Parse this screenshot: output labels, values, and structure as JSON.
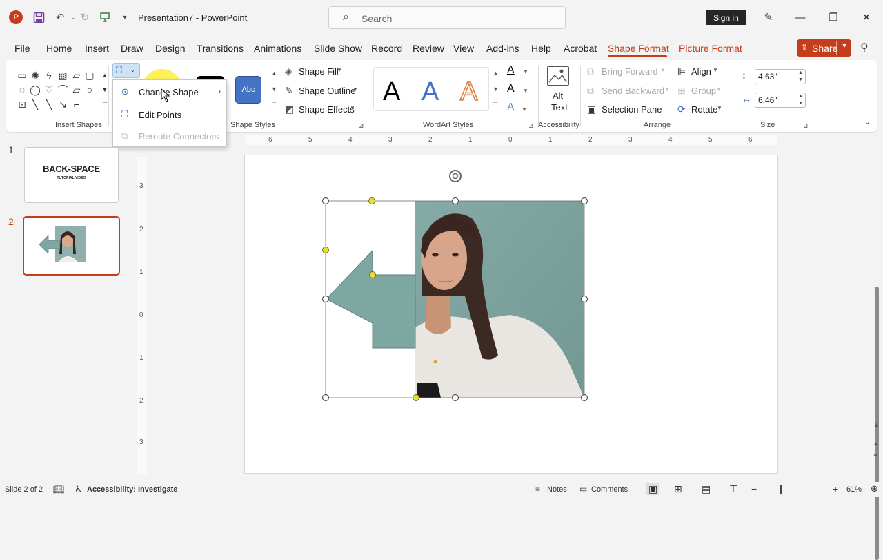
{
  "titlebar": {
    "doc_title": "Presentation7  -  PowerPoint",
    "search_placeholder": "Search",
    "signin_label": "Sign in"
  },
  "tabs": [
    "File",
    "Home",
    "Insert",
    "Draw",
    "Design",
    "Transitions",
    "Animations",
    "Slide Show",
    "Record",
    "Review",
    "View",
    "Add-ins",
    "Help",
    "Acrobat",
    "Shape Format",
    "Picture Format"
  ],
  "active_tab": "Shape Format",
  "share_label": "Share",
  "ribbon": {
    "groups": {
      "insert_shapes": "Insert Shapes",
      "shape_styles": "Shape Styles",
      "wordart_styles": "WordArt Styles",
      "accessibility": "Accessibility",
      "arrange": "Arrange",
      "size": "Size"
    },
    "style_sample_text": "Abc",
    "shape_fill": "Shape Fill",
    "shape_outline": "Shape Outline",
    "shape_effects": "Shape Effects",
    "alt_text": [
      "Alt",
      "Text"
    ],
    "bring_forward": "Bring Forward",
    "send_backward": "Send Backward",
    "selection_pane": "Selection Pane",
    "align": "Align",
    "group": "Group",
    "rotate": "Rotate",
    "height_value": "4.63\"",
    "width_value": "6.46\"",
    "wordart_letter": "A"
  },
  "edit_shape_menu": [
    {
      "label": "Change Shape",
      "enabled": true,
      "submenu": true
    },
    {
      "label": "Edit Points",
      "enabled": true,
      "submenu": false
    },
    {
      "label": "Reroute Connectors",
      "enabled": false,
      "submenu": false
    }
  ],
  "slides": [
    {
      "number": "1",
      "title": "BACK-SPACE",
      "subtitle": "TUTORIAL VIDEO"
    },
    {
      "number": "2",
      "title": "",
      "subtitle": ""
    }
  ],
  "selected_slide": "2",
  "h_ruler_numbers": [
    "6",
    "5",
    "4",
    "3",
    "2",
    "1",
    "0",
    "1",
    "2",
    "3",
    "4",
    "5",
    "6"
  ],
  "v_ruler_numbers": [
    "3",
    "2",
    "1",
    "0",
    "1",
    "2",
    "3"
  ],
  "statusbar": {
    "slide_info": "Slide 2 of 2",
    "accessibility": "Accessibility: Investigate",
    "notes": "Notes",
    "comments": "Comments",
    "zoom": "61%"
  },
  "colors": {
    "accent": "#c43e1c",
    "shape_fill": "#7fa7a2",
    "handle_yellow": "#e8e030"
  }
}
